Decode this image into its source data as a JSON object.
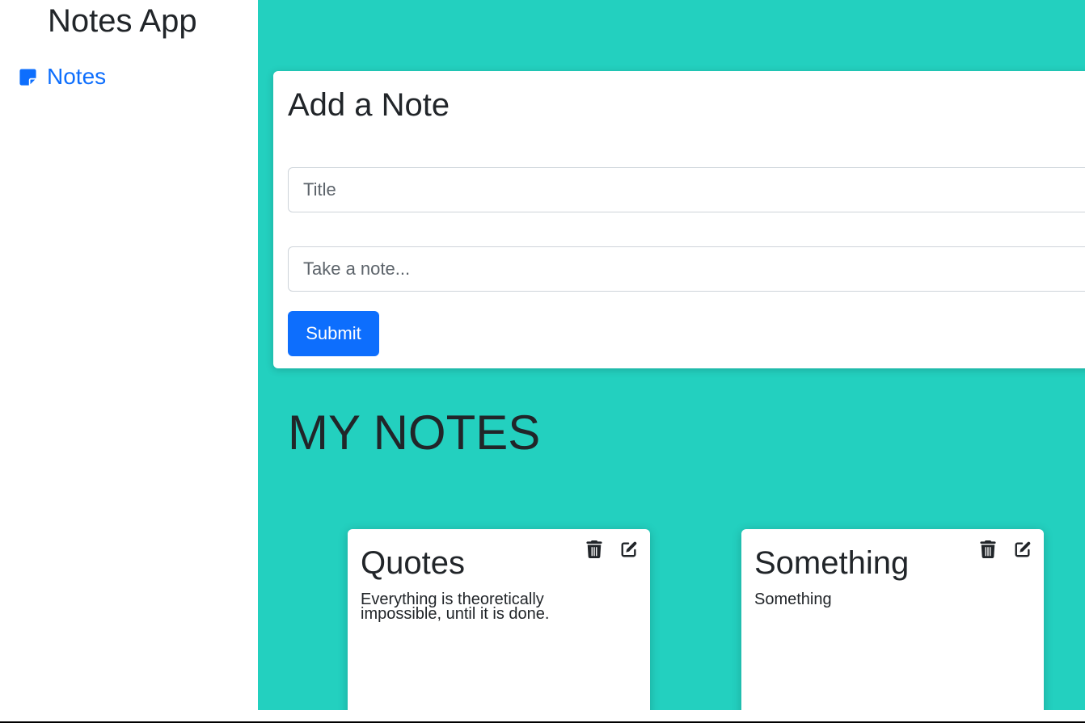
{
  "sidebar": {
    "brand": "Notes App",
    "nav": [
      {
        "label": "Notes",
        "icon": "sticky-note-icon",
        "color": "#0d6efd"
      }
    ]
  },
  "form": {
    "heading": "Add a Note",
    "title_placeholder": "Title",
    "title_value": "",
    "note_placeholder": "Take a note...",
    "note_value": "",
    "submit_label": "Submit",
    "submit_color": "#0d6efd"
  },
  "notes_section": {
    "heading": "MY NOTES",
    "notes": [
      {
        "title": "Quotes",
        "body": "Everything is theoretically impossible, until it is done."
      },
      {
        "title": "Something",
        "body": "Something"
      }
    ],
    "note_actions": [
      "trash-icon",
      "edit-icon"
    ]
  },
  "colors": {
    "main_background": "#23d0bf",
    "sidebar_background": "#ffffff",
    "link": "#0d6efd",
    "text": "#212529"
  }
}
